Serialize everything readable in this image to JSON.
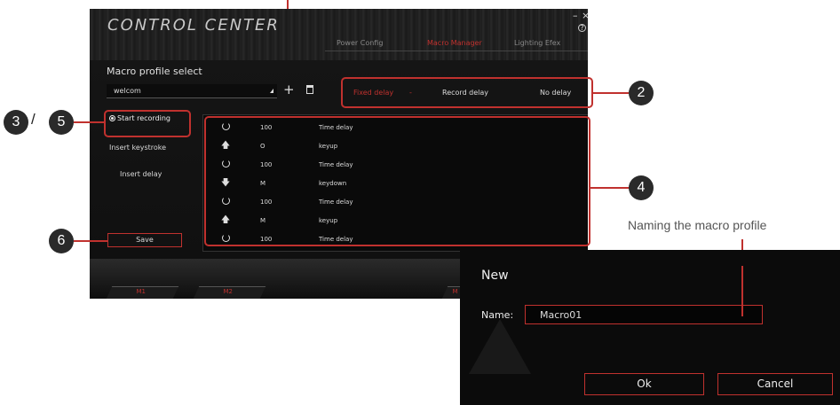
{
  "window": {
    "title": "CONTROL CENTER",
    "minimize": "–",
    "close": "×",
    "help": "?",
    "tabs": [
      {
        "label": "Power Config",
        "active": false
      },
      {
        "label": "Macro Manager",
        "active": true
      },
      {
        "label": "Lighting Efex",
        "active": false
      }
    ]
  },
  "macro": {
    "profile_label": "Macro profile select",
    "profile_value": "welcom",
    "add": "+",
    "delay_options": [
      {
        "label": "Fixed delay",
        "active": true
      },
      {
        "label": "-",
        "active": true
      },
      {
        "label": "Record delay",
        "active": false
      },
      {
        "label": "No delay",
        "active": false
      }
    ],
    "start_recording": "Start recording",
    "insert_keystroke": "Insert keystroke",
    "insert_delay": "Insert delay",
    "save": "Save",
    "rows": [
      {
        "icon": "timer-icon",
        "key": "100",
        "action": "Time delay"
      },
      {
        "icon": "arrow-up-icon",
        "key": "O",
        "action": "keyup"
      },
      {
        "icon": "timer-icon",
        "key": "100",
        "action": "Time delay"
      },
      {
        "icon": "arrow-down-icon",
        "key": "M",
        "action": "keydown"
      },
      {
        "icon": "timer-icon",
        "key": "100",
        "action": "Time delay"
      },
      {
        "icon": "arrow-up-icon",
        "key": "M",
        "action": "keyup"
      },
      {
        "icon": "timer-icon",
        "key": "100",
        "action": "Time delay"
      }
    ],
    "m_buttons": [
      "M1",
      "M2",
      "M"
    ]
  },
  "callouts": {
    "c2": "2",
    "c3": "3",
    "slash": "/",
    "c5": "5",
    "c4": "4",
    "c6": "6"
  },
  "naming_label": "Naming the macro profile",
  "dialog": {
    "title": "New",
    "name_label": "Name:",
    "name_value": "Macro01",
    "ok": "Ok",
    "cancel": "Cancel"
  },
  "colors": {
    "accent": "#c0312e",
    "background": "#101010"
  }
}
